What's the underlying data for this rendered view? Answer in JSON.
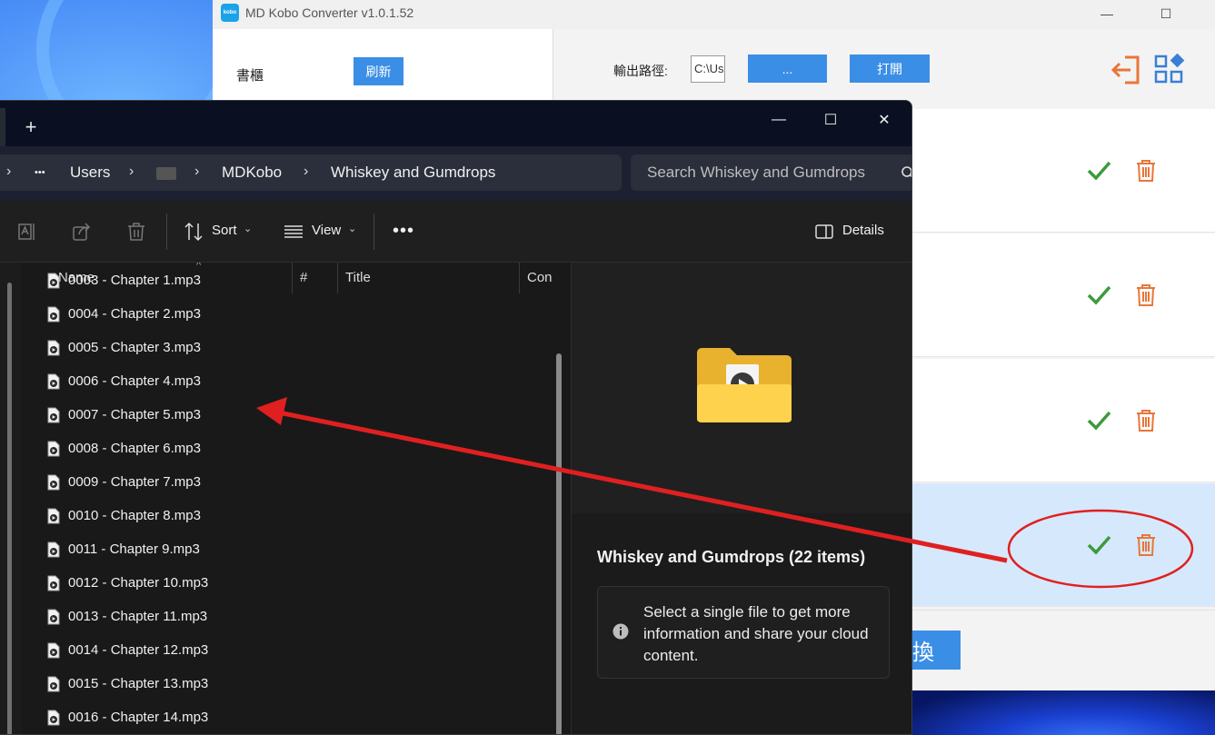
{
  "kobo": {
    "logo_text": "kobo",
    "title": "MD Kobo Converter v1.0.1.52",
    "minimize": "—",
    "maximize": "☐",
    "shelf_label": "書櫃",
    "refresh_label": "刷新",
    "output_label": "輸出路徑:",
    "output_path": "C:\\Us",
    "browse_label": "...",
    "open_label": "打開",
    "convert_label": "換",
    "rows": 4
  },
  "explorer": {
    "new_tab": "+",
    "minimize": "—",
    "maximize": "☐",
    "close": "✕",
    "breadcrumb": {
      "sep": "›",
      "more": "•••",
      "users": "Users",
      "mdkobo": "MDKobo",
      "folder": "Whiskey and Gumdrops"
    },
    "search_placeholder": "Search Whiskey and Gumdrops",
    "toolbar": {
      "sort_label": "Sort",
      "view_label": "View",
      "more": "•••",
      "details_label": "Details"
    },
    "columns": {
      "name": "Name",
      "number": "#",
      "title": "Title",
      "contributing": "Con"
    },
    "files": [
      "0003 - Chapter 1.mp3",
      "0004 - Chapter 2.mp3",
      "0005 - Chapter 3.mp3",
      "0006 - Chapter 4.mp3",
      "0007 - Chapter 5.mp3",
      "0008 - Chapter 6.mp3",
      "0009 - Chapter 7.mp3",
      "0010 - Chapter 8.mp3",
      "0011 - Chapter 9.mp3",
      "0012 - Chapter 10.mp3",
      "0013 - Chapter 11.mp3",
      "0014 - Chapter 12.mp3",
      "0015 - Chapter 13.mp3",
      "0016 - Chapter 14.mp3"
    ],
    "details": {
      "title": "Whiskey and Gumdrops (22 items)",
      "info": "Select a single file to get more information and share your cloud content."
    }
  },
  "colors": {
    "accent_blue": "#3a8ee6",
    "check_green": "#3c9a3c",
    "trash_orange": "#e8763a",
    "annotation_red": "#e02020"
  }
}
